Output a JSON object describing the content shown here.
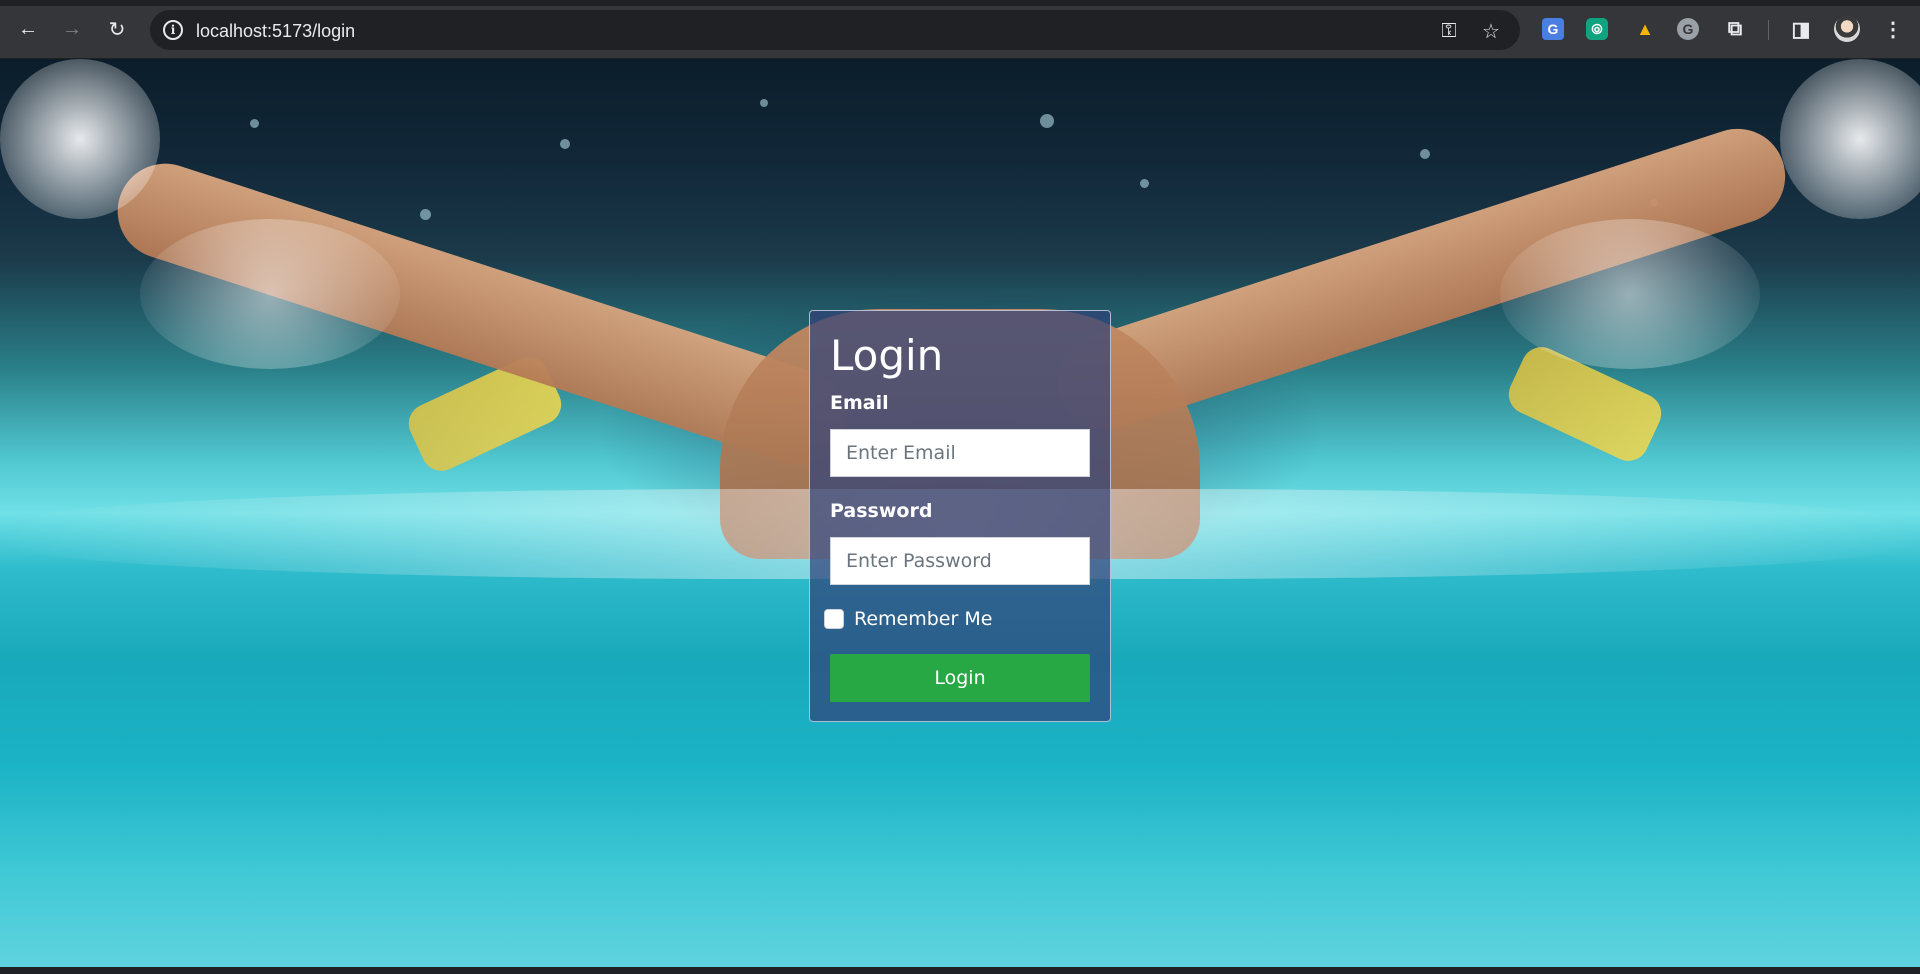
{
  "browser": {
    "url": "localhost:5173/login",
    "icons": {
      "back": "arrow-left-icon",
      "forward": "arrow-right-icon",
      "reload": "reload-icon",
      "site_info": "info-icon",
      "password_key": "key-icon",
      "bookmark": "star-icon",
      "extensions": [
        "google-translate-icon",
        "chatgpt-icon",
        "google-drive-icon",
        "grammarly-icon",
        "puzzle-icon"
      ],
      "side_panel": "side-panel-icon",
      "profile": "avatar",
      "menu": "kebab-menu-icon"
    },
    "glyphs": {
      "back": "←",
      "forward": "→",
      "reload": "↻",
      "site_info": "i",
      "key": "⚿",
      "star": "☆",
      "translate": "G",
      "chatgpt": "⦾",
      "drive": "▲",
      "grammarly": "G",
      "puzzle": "⧉",
      "side_panel": "◨",
      "menu": "⋮"
    }
  },
  "login": {
    "title": "Login",
    "email_label": "Email",
    "email_placeholder": "Enter Email",
    "email_value": "",
    "password_label": "Password",
    "password_placeholder": "Enter Password",
    "password_value": "",
    "remember_label": "Remember Me",
    "remember_checked": false,
    "button_label": "Login"
  },
  "colors": {
    "card_bg": "#304278",
    "button_bg": "#28a745",
    "chrome_bg": "#35363a",
    "omnibox_bg": "#202124"
  }
}
